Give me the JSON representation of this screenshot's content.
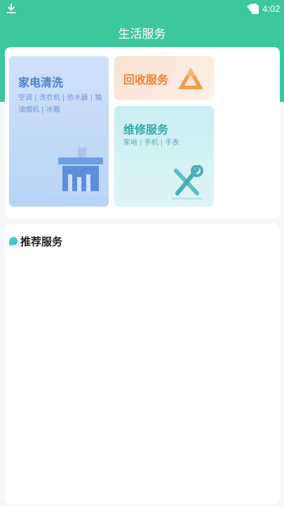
{
  "status_bar": {
    "time": "4:02",
    "icons": [
      "download-icon",
      "wifi-icon",
      "battery-icon"
    ]
  },
  "header": {
    "title": "生活服务",
    "background_color": "#3cc79f"
  },
  "services": {
    "appliance_cleaning": {
      "title": "家电清洗",
      "items_text": "空调 | 洗衣机 | 热水器 | 抽油烟机 | 冰箱",
      "icon": "cleaning-brush-icon",
      "color": "#4d7fcf"
    },
    "recycling": {
      "title": "回收服务",
      "icon": "recycle-icon",
      "color": "#f07f3a"
    },
    "repair": {
      "title": "维修服务",
      "items_text": "家电 | 手机 | 手表",
      "icon": "repair-tools-icon",
      "color": "#38a8a8"
    }
  },
  "recommended": {
    "title": "推荐服务",
    "icon": "leaf-dot-icon"
  }
}
